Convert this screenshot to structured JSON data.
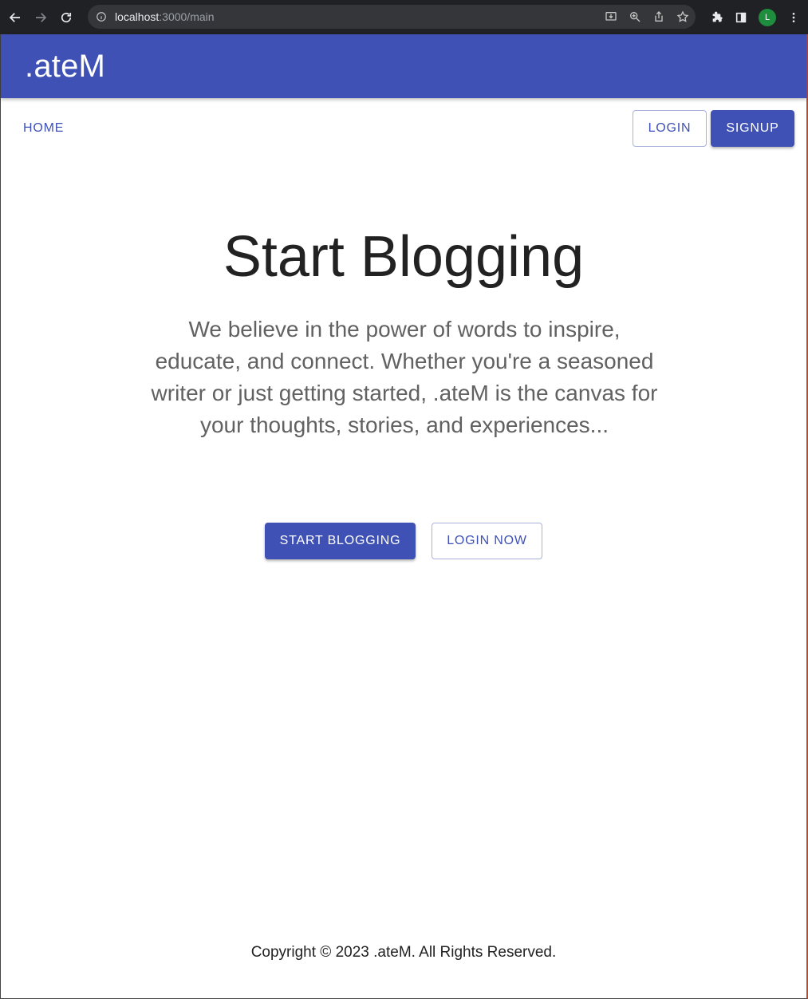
{
  "browser": {
    "url_host": "localhost",
    "url_path": ":3000/main",
    "profile_initial": "L"
  },
  "app": {
    "brand": ".ateM"
  },
  "nav": {
    "home": "HOME",
    "login": "LOGIN",
    "signup": "SIGNUP"
  },
  "hero": {
    "title": "Start Blogging",
    "description": "We believe in the power of words to inspire, educate, and connect. Whether you're a seasoned writer or just getting started, .ateM is the canvas for your thoughts, stories, and experiences...",
    "start_button": "START BLOGGING",
    "login_button": "LOGIN NOW"
  },
  "footer": {
    "copyright": "Copyright © 2023 .ateM. All Rights Reserved."
  },
  "colors": {
    "primary": "#3f51b5",
    "browser_chrome": "#202124"
  }
}
